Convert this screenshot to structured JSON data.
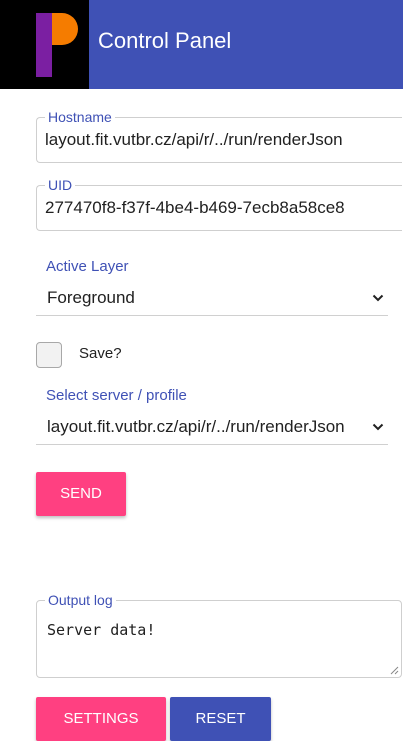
{
  "header": {
    "title": "Control Panel",
    "colors": {
      "bar": "#3f51b5",
      "logo_background": "#000000",
      "logo_purple": "#7b1fa2",
      "logo_orange": "#f57c00"
    },
    "logo_icon": "logo-icon"
  },
  "form": {
    "hostname": {
      "label": "Hostname",
      "value": "layout.fit.vutbr.cz/api/r/../run/renderJson"
    },
    "uid": {
      "label": "UID",
      "value": "277470f8-f37f-4be4-b469-7ecb8a58ce8"
    },
    "active_layer": {
      "label": "Active Layer",
      "value": "Foreground",
      "icon": "chevron-down-icon"
    },
    "save": {
      "label": "Save?",
      "checked": false
    },
    "server": {
      "label": "Select server / profile",
      "value": "layout.fit.vutbr.cz/api/r/../run/renderJson",
      "icon": "chevron-down-icon"
    },
    "send_label": "SEND"
  },
  "output": {
    "label": "Output log",
    "value": "Server data!"
  },
  "footer": {
    "settings_label": "SETTINGS",
    "reset_label": "RESET"
  },
  "colors": {
    "primary": "#3f51b5",
    "accent": "#ff4081"
  }
}
